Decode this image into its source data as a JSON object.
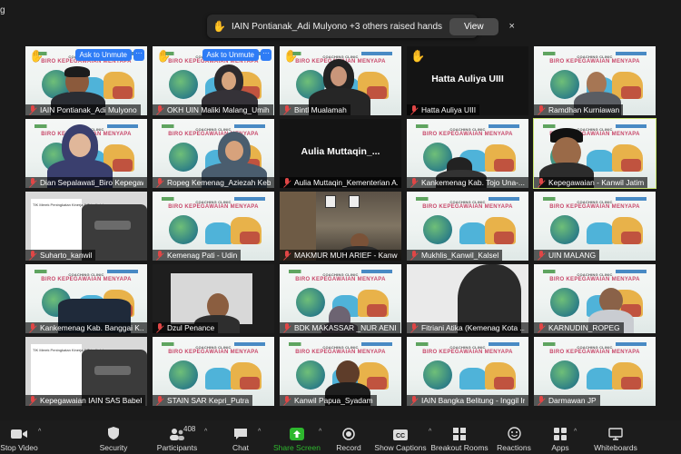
{
  "corner_label": "g",
  "raise_banner": {
    "text": "IAIN Pontianak_Adi Mulyono +3 others raised hands",
    "view_label": "View",
    "close_label": "×"
  },
  "background_text": {
    "coaching": "COACHING CLINIC",
    "biro": "BIRO KEPEGAWAIAN MENYAPA"
  },
  "slide_text": "TIK Merek Peningkatan Kinerja & Tata Kelola",
  "ask_to_unmute": "Ask to Unmute",
  "more_label": "···",
  "tiles": [
    {
      "name": "IAIN Pontianak_Adi Mulyono"
    },
    {
      "name": "OKH UIN Maliki Malang_Umih"
    },
    {
      "name": "Bintl Mualamah"
    },
    {
      "name": "Hatta Auliya UIII",
      "big": "Hatta Auliya UIII"
    },
    {
      "name": "Ramdhan Kurniawan"
    },
    {
      "name": "Dian Sepalawati_Biro Kepegawai..."
    },
    {
      "name": "Ropeg Kemenag_Aziezah Keb..."
    },
    {
      "name": "Aulia Muttaqin_Kementerian A...",
      "big": "Aulia  Muttaqin_..."
    },
    {
      "name": "Kankemenag Kab. Tojo Una-..."
    },
    {
      "name": "Kepegawaian - Kanwil Jatim"
    },
    {
      "name": "Suharto_kanwil"
    },
    {
      "name": "Kemenag Pati - Udin"
    },
    {
      "name": "MAKMUR MUH ARIEF - Kanwi..."
    },
    {
      "name": "Mukhlis_Kanwil_Kalsel"
    },
    {
      "name": "UIN MALANG"
    },
    {
      "name": "Kankemenag Kab. Banggai K..."
    },
    {
      "name": "Dzul Penance"
    },
    {
      "name": "BDK MAKASSAR _NUR AENI"
    },
    {
      "name": "Fitriani Atika (Kemenag Kota ..."
    },
    {
      "name": "KARNUDIN_ROPEG"
    },
    {
      "name": "Kepegawaian IAIN SAS Babel"
    },
    {
      "name": "STAIN SAR Kepri_Putra"
    },
    {
      "name": "Kanwil Papua_Syadam"
    },
    {
      "name": "IAIN Bangka Belitung - Inggil Ir..."
    },
    {
      "name": "Darmawan JP"
    }
  ],
  "toolbar": {
    "participants_count": "408",
    "buttons": [
      "Stop Video",
      "Security",
      "Participants",
      "Chat",
      "Share Screen",
      "Record",
      "Show Captions",
      "Breakout Rooms",
      "Reactions",
      "Apps",
      "Whiteboards"
    ],
    "share_color": "#2eb82e",
    "mic_color": "#e04646"
  }
}
